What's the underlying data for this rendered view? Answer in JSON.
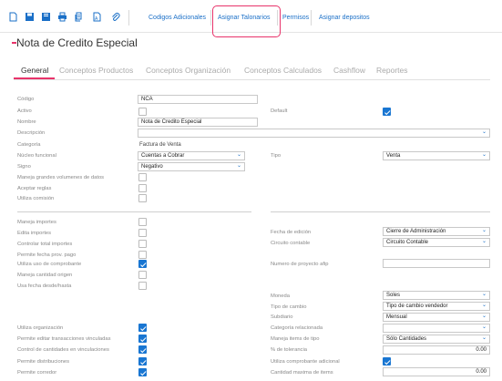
{
  "toolbar": {
    "icons": [
      "new-document-icon",
      "save-icon",
      "save-close-icon",
      "print-icon",
      "copy-document-icon",
      "export-pdf-icon",
      "attach-icon"
    ],
    "links": [
      "Codigos Adicionales",
      "Asignar Talonarios",
      "Permisos",
      "Asignar depositos"
    ],
    "highlight_color": "#e8336a",
    "link_color": "#1a6fc7"
  },
  "title": "Nota de Credito Especial",
  "tabs": [
    "General",
    "Conceptos Productos",
    "Conceptos Organización",
    "Conceptos Calculados",
    "Cashflow",
    "Reportes"
  ],
  "active_tab": "General",
  "form": {
    "codigo": {
      "label": "Código",
      "value": "NCA"
    },
    "activo": {
      "label": "Activo",
      "checked": false
    },
    "default": {
      "label": "Default",
      "checked": true
    },
    "nombre": {
      "label": "Nombre",
      "value": "Nota de Credito Especial"
    },
    "descripcion": {
      "label": "Descripción",
      "value": ""
    },
    "categoria": {
      "label": "Categoría",
      "value": "Factura de Venta"
    },
    "nucleo": {
      "label": "Núcleo funcional",
      "value": "Cuentas a Cobrar"
    },
    "tipo": {
      "label": "Tipo",
      "value": "Venta"
    },
    "signo": {
      "label": "Signo",
      "value": "Negativo"
    },
    "maneja_grandes": {
      "label": "Maneja grandes volumenes de datos",
      "checked": false
    },
    "aceptar_reglas": {
      "label": "Aceptar reglas",
      "checked": false
    },
    "utiliza_comision": {
      "label": "Utiliza comisión",
      "checked": false
    },
    "maneja_importes": {
      "label": "Maneja importes",
      "checked": false
    },
    "edita_importes": {
      "label": "Edita importes",
      "checked": false
    },
    "controlar_total": {
      "label": "Controlar total importes",
      "checked": false
    },
    "permite_fecha": {
      "label": "Permite fecha prov. pago",
      "checked": false
    },
    "utiliza_uso": {
      "label": "Utiliza uso de comprobante",
      "checked": true
    },
    "maneja_cantidad": {
      "label": "Maneja cantidad origen",
      "checked": false
    },
    "usa_fecha": {
      "label": "Usa fecha desde/hasta",
      "checked": false
    },
    "fecha_edicion": {
      "label": "Fecha de edición",
      "value": "Cierre de Administración"
    },
    "circuito": {
      "label": "Circuito contable",
      "value": "Circuito Contable"
    },
    "numero_proyecto": {
      "label": "Numero de proyecto afip",
      "value": ""
    },
    "moneda": {
      "label": "Moneda",
      "value": "Soles"
    },
    "tipo_cambio": {
      "label": "Tipo de cambio",
      "value": "Tipo de cambio vendedor"
    },
    "subdiario": {
      "label": "Subdiario",
      "value": "Mensual"
    },
    "utiliza_org": {
      "label": "Utiliza organización",
      "checked": true
    },
    "categoria_rel": {
      "label": "Categoría relacionada",
      "value": ""
    },
    "permite_editar": {
      "label": "Permite editar transacciones vinculadas",
      "checked": true
    },
    "maneja_items": {
      "label": "Maneja items de tipo",
      "value": "Sólo Cantidades"
    },
    "control_cantidades": {
      "label": "Control de cantidades en vinculaciones",
      "checked": true
    },
    "pct_tolerancia": {
      "label": "% de tolerancia",
      "value": "0.00"
    },
    "permite_distribuciones": {
      "label": "Permite distribuciones",
      "checked": true
    },
    "utiliza_comp_adicional": {
      "label": "Utiliza comprobante adicional",
      "checked": true
    },
    "permite_corredor": {
      "label": "Permite corredor",
      "checked": true
    },
    "cantidad_maxima": {
      "label": "Cantidad maxima de items",
      "value": "0.00"
    }
  }
}
